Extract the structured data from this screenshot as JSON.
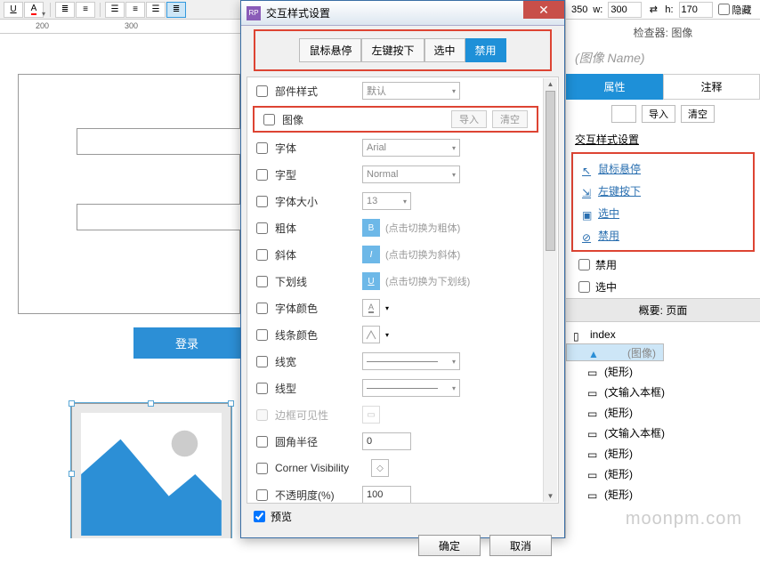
{
  "toolbar": {
    "x_label": "350",
    "w_label": "w:",
    "w_val": "300",
    "h_label": "h:",
    "h_val": "170",
    "hidden": "隐藏"
  },
  "ruler": {
    "t1": "200",
    "t2": "300"
  },
  "canvas": {
    "login": "登录"
  },
  "dialog": {
    "icon": "RP",
    "title": "交互样式设置",
    "tabs": [
      "鼠标悬停",
      "左键按下",
      "选中",
      "禁用"
    ],
    "rows": {
      "widget_style": "部件样式",
      "default": "默认",
      "image": "图像",
      "import": "导入",
      "clear": "清空",
      "font": "字体",
      "font_val": "Arial",
      "style": "字型",
      "style_val": "Normal",
      "size": "字体大小",
      "size_val": "13",
      "bold": "粗体",
      "bold_btn": "B",
      "bold_hint": "(点击切换为粗体)",
      "italic": "斜体",
      "italic_btn": "I",
      "italic_hint": "(点击切换为斜体)",
      "underline": "下划线",
      "underline_btn": "U",
      "underline_hint": "(点击切换为下划线)",
      "font_color": "字体颜色",
      "line_color": "线条颜色",
      "line_width": "线宽",
      "line_type": "线型",
      "border_vis": "边框可见性",
      "corner": "圆角半径",
      "corner_val": "0",
      "corner_vis": "Corner Visibility",
      "opacity": "不透明度(%)",
      "opacity_val": "100"
    },
    "preview": "预览",
    "ok": "确定",
    "cancel": "取消"
  },
  "inspector": {
    "title": "检查器: 图像",
    "name_hint": "(图像 Name)",
    "tabs": [
      "属性",
      "注释"
    ],
    "import": "导入",
    "clear": "清空",
    "section": "交互样式设置",
    "links": [
      "鼠标悬停",
      "左键按下",
      "选中",
      "禁用"
    ],
    "disable": "禁用",
    "select": "选中",
    "outline_title": "概要: 页面",
    "tree": [
      "index",
      "(图像)",
      "(矩形)",
      "(文输入本框)",
      "(矩形)",
      "(文输入本框)",
      "(矩形)",
      "(矩形)",
      "(矩形)"
    ]
  },
  "watermark": "moonpm.com"
}
